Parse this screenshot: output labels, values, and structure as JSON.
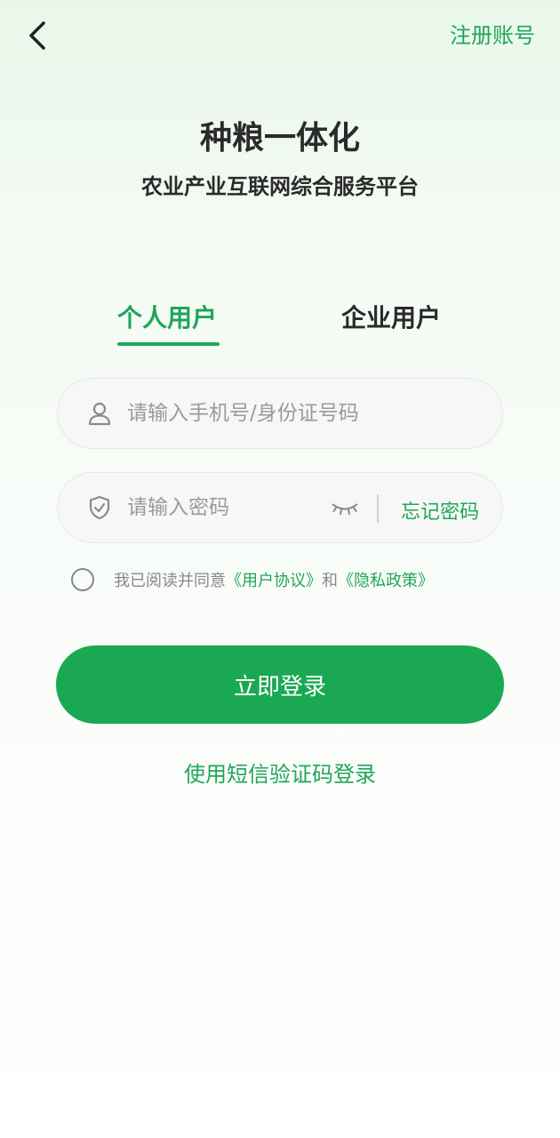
{
  "header": {
    "back_icon": "chevron-left-icon",
    "register_label": "注册账号"
  },
  "branding": {
    "title": "种粮一体化",
    "subtitle": "农业产业互联网综合服务平台"
  },
  "tabs": [
    {
      "label": "个人用户",
      "active": true
    },
    {
      "label": "企业用户",
      "active": false
    }
  ],
  "form": {
    "phone": {
      "icon": "user-icon",
      "placeholder": "请输入手机号/身份证号码",
      "value": ""
    },
    "password": {
      "icon": "shield-icon",
      "placeholder": "请输入密码",
      "value": "",
      "toggle_icon": "eye-closed-icon",
      "forgot_label": "忘记密码"
    },
    "agreement": {
      "checked": false,
      "prefix": "我已阅读并同意",
      "user_agreement": "《用户协议》",
      "conjunction": "和",
      "privacy_policy": "《隐私政策》"
    },
    "submit_label": "立即登录",
    "alt_login_label": "使用短信验证码登录"
  },
  "colors": {
    "accent": "#21a55a",
    "button": "#1aa952",
    "text": "#2a2a2a",
    "muted": "#9a9a9a"
  }
}
